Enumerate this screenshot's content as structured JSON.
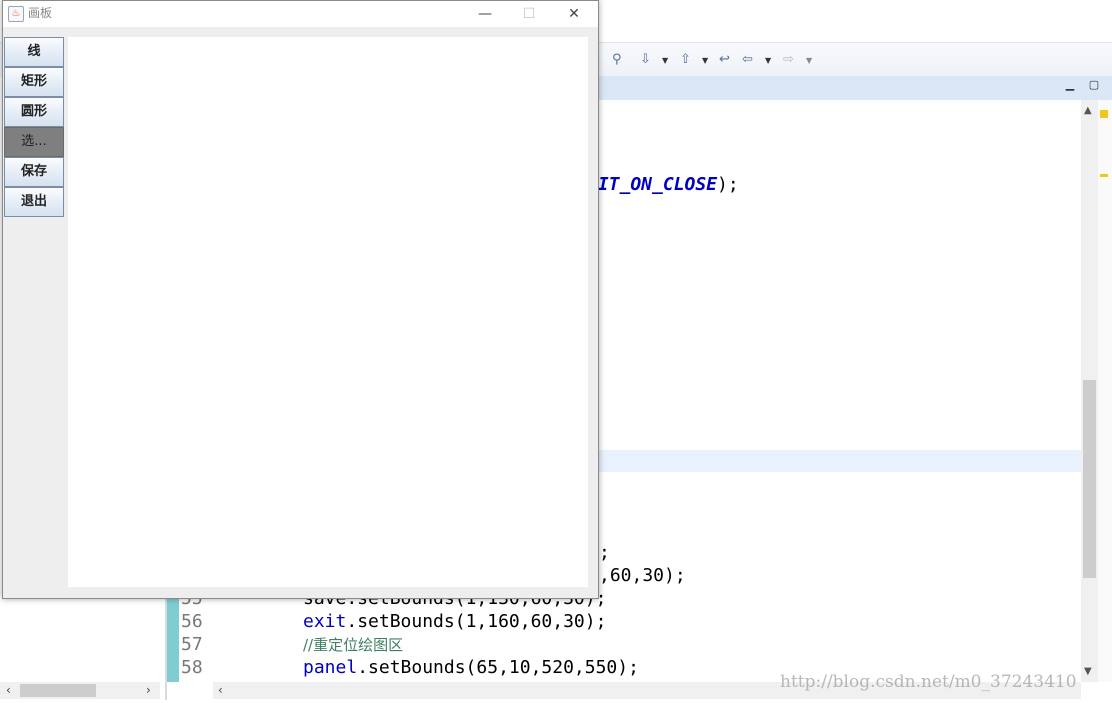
{
  "ide": {
    "toolbar_icons": [
      "pin-icon",
      "step-into-icon",
      "dropdown-arrow",
      "step-return-icon",
      "dropdown-arrow",
      "back-history-icon",
      "back-arrow-icon",
      "dropdown-arrow",
      "forward-arrow-icon",
      "dropdown-arrow"
    ],
    "code_lines": {
      "partial_close": "XIT_ON_CLOSE",
      "partial_close_tail": ");",
      "line_53_tail": ";",
      "line_54_tail": ",60,30);",
      "line_55": "save.setBounds(1,130,60,30);",
      "line_56_obj": "exit",
      "line_56_rest": ".setBounds(1,160,60,30);",
      "line_57_comment": "//重定位绘图区",
      "line_58_obj": "panel",
      "line_58_rest": ".setBounds(65,10,520,550);"
    },
    "line_numbers": [
      "55",
      "56",
      "57",
      "58"
    ],
    "watermark": "http://blog.csdn.net/m0_37243410"
  },
  "window": {
    "title": "画板",
    "controls": {
      "minimize": "—",
      "maximize": "☐",
      "close": "✕"
    },
    "buttons": [
      {
        "label": "线",
        "selected": false
      },
      {
        "label": "矩形",
        "selected": false
      },
      {
        "label": "圆形",
        "selected": false
      },
      {
        "label": "选...",
        "selected": true
      },
      {
        "label": "保存",
        "selected": false
      },
      {
        "label": "退出",
        "selected": false
      }
    ]
  },
  "colors": {
    "selected_button": "#7f7f7f",
    "keyword_const": "#0000c0",
    "comment": "#3f7f5f",
    "highlight_line": "#e8f2fe"
  }
}
